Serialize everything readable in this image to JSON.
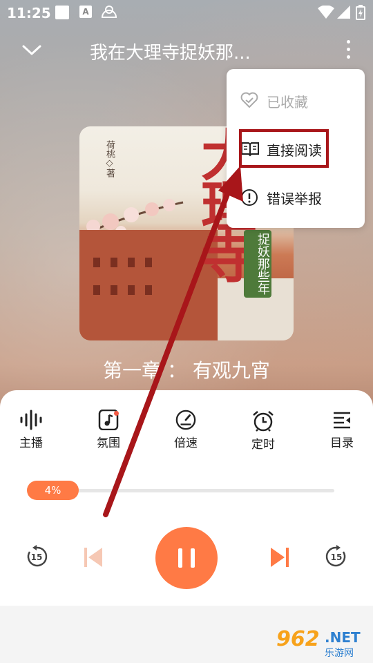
{
  "status_bar": {
    "time": "11:25",
    "app_icon_letter": "A"
  },
  "header": {
    "title": "我在大理寺捉妖那..."
  },
  "cover": {
    "title_main": "大理寺",
    "subtitle": "捉妖那些年",
    "author": "荷桃◇著"
  },
  "chapter": {
    "title": "第一章 ： 有观九宵"
  },
  "functions": [
    {
      "label": "主播",
      "icon": "voice-wave-icon"
    },
    {
      "label": "氛围",
      "icon": "music-note-icon"
    },
    {
      "label": "倍速",
      "icon": "speed-gauge-icon"
    },
    {
      "label": "定时",
      "icon": "alarm-clock-icon"
    },
    {
      "label": "目录",
      "icon": "list-icon"
    }
  ],
  "progress": {
    "label": "4%",
    "value": 0.04
  },
  "controls": {
    "rewind_seconds": "15",
    "forward_seconds": "15"
  },
  "menu": {
    "items": [
      {
        "label": "已收藏",
        "icon": "heart-check-icon",
        "disabled": true
      },
      {
        "label": "直接阅读",
        "icon": "book-open-icon",
        "highlighted": true
      },
      {
        "label": "错误举报",
        "icon": "exclamation-circle-icon"
      }
    ]
  },
  "watermark": {
    "number": "962",
    "domain": ".NET",
    "site_name": "乐游网"
  },
  "colors": {
    "accent": "#ff7a45",
    "annotation": "#a8161a",
    "panel": "#ffffff"
  }
}
